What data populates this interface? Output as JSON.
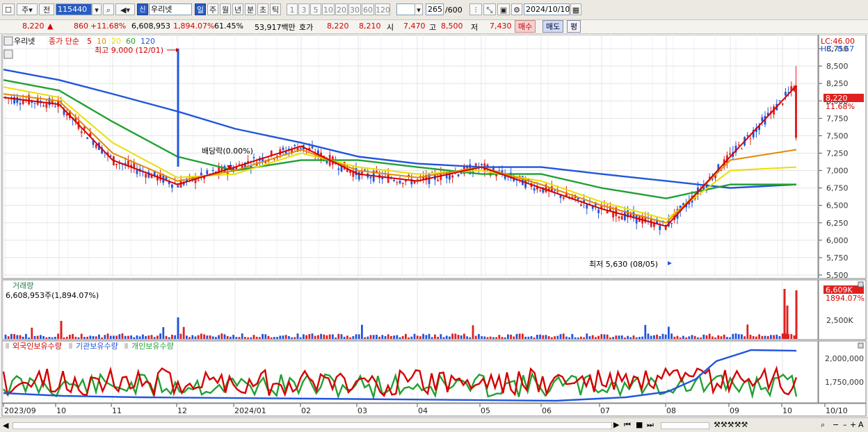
{
  "toolbar": {
    "type_label": "주",
    "prev_label": "전",
    "code": "115440",
    "name": "우리넷",
    "new_badge": "신",
    "periods": [
      "일",
      "주",
      "월",
      "년",
      "분",
      "초",
      "틱"
    ],
    "selected_period": "일",
    "minutes": [
      "1",
      "3",
      "5",
      "10",
      "20",
      "30",
      "60",
      "120"
    ],
    "count": "265",
    "count_total": "/600",
    "date": "2024/10/10"
  },
  "quote": {
    "price": "8,220",
    "change": "860",
    "change_pct": "+11.68%",
    "volume": "6,608,953",
    "volume_pct": "1,894.07%",
    "turnover": "61.45%",
    "amount": "53,917백만",
    "hoga_label": "호가",
    "hoga1": "8,220",
    "hoga2": "8,210",
    "open_label": "시",
    "open": "7,470",
    "high_label": "고",
    "high": "8,500",
    "low_label": "저",
    "low": "7,430",
    "buy_label": "매수",
    "sell_label": "매도",
    "pyeong_label": "평"
  },
  "price_pane": {
    "title": "우리넷",
    "ma_label": "종가 단순",
    "ma_periods": [
      "5",
      "10",
      "20",
      "60",
      "120"
    ],
    "ma_colors": [
      "#d40000",
      "#e08a00",
      "#e8e000",
      "#22a033",
      "#2255dd"
    ],
    "high_note": "최고 9,000 (12/01)",
    "low_note": "최저 5,630 (08/05)",
    "dividend_note": "배당락(0.00%)",
    "lc": "LC:46.00",
    "hc": "HC:-8.67",
    "current_price_tag": "8,220",
    "current_pct_tag": "11.68%"
  },
  "volume_pane": {
    "title": "거래량",
    "value": "6,608,953주(1,894.07%)",
    "tag_value": "6,609K",
    "tag_pct": "1894.07%",
    "axis_label": "2,500K"
  },
  "holding_pane": {
    "labels": [
      "외국인보유수량",
      "기관보유수량",
      "개인보유수량"
    ],
    "label_colors": [
      "#d40000",
      "#2255dd",
      "#22a033"
    ],
    "axis_labels": [
      "2,000,000",
      "1,750,000"
    ]
  },
  "x_axis": [
    "2023/09",
    "10",
    "11",
    "12",
    "2024/01",
    "02",
    "03",
    "04",
    "05",
    "06",
    "07",
    "08",
    "09",
    "10",
    "10/10"
  ],
  "chart_data": {
    "type": "line",
    "title": "우리넷",
    "price_axis": [
      8750,
      8500,
      8250,
      8000,
      7750,
      7500,
      7250,
      7000,
      6750,
      6500,
      6250,
      6000,
      5750,
      5500
    ],
    "x": [
      "2023/09",
      "10",
      "11",
      "12",
      "2024/01",
      "02",
      "03",
      "04",
      "05",
      "06",
      "07",
      "08",
      "09",
      "10"
    ],
    "series": [
      {
        "name": "5",
        "values": [
          8050,
          7950,
          7150,
          6800,
          7050,
          7350,
          6950,
          6850,
          7050,
          6750,
          6450,
          6200,
          7200,
          8220
        ]
      },
      {
        "name": "10",
        "values": [
          8100,
          8000,
          7250,
          6850,
          7000,
          7300,
          7000,
          6900,
          7050,
          6800,
          6500,
          6250,
          7150,
          7300
        ]
      },
      {
        "name": "20",
        "values": [
          8200,
          8050,
          7400,
          6900,
          6950,
          7250,
          7050,
          6950,
          7000,
          6850,
          6550,
          6300,
          7000,
          7050
        ]
      },
      {
        "name": "60",
        "values": [
          8300,
          8150,
          7700,
          7200,
          7000,
          7150,
          7150,
          7050,
          6950,
          6950,
          6750,
          6600,
          6800,
          6800
        ]
      },
      {
        "name": "120",
        "values": [
          8450,
          8300,
          8100,
          7850,
          7600,
          7400,
          7200,
          7100,
          7050,
          7050,
          6950,
          6850,
          6750,
          6800
        ]
      }
    ],
    "ylim": [
      5450,
      8950
    ],
    "grid": true
  }
}
